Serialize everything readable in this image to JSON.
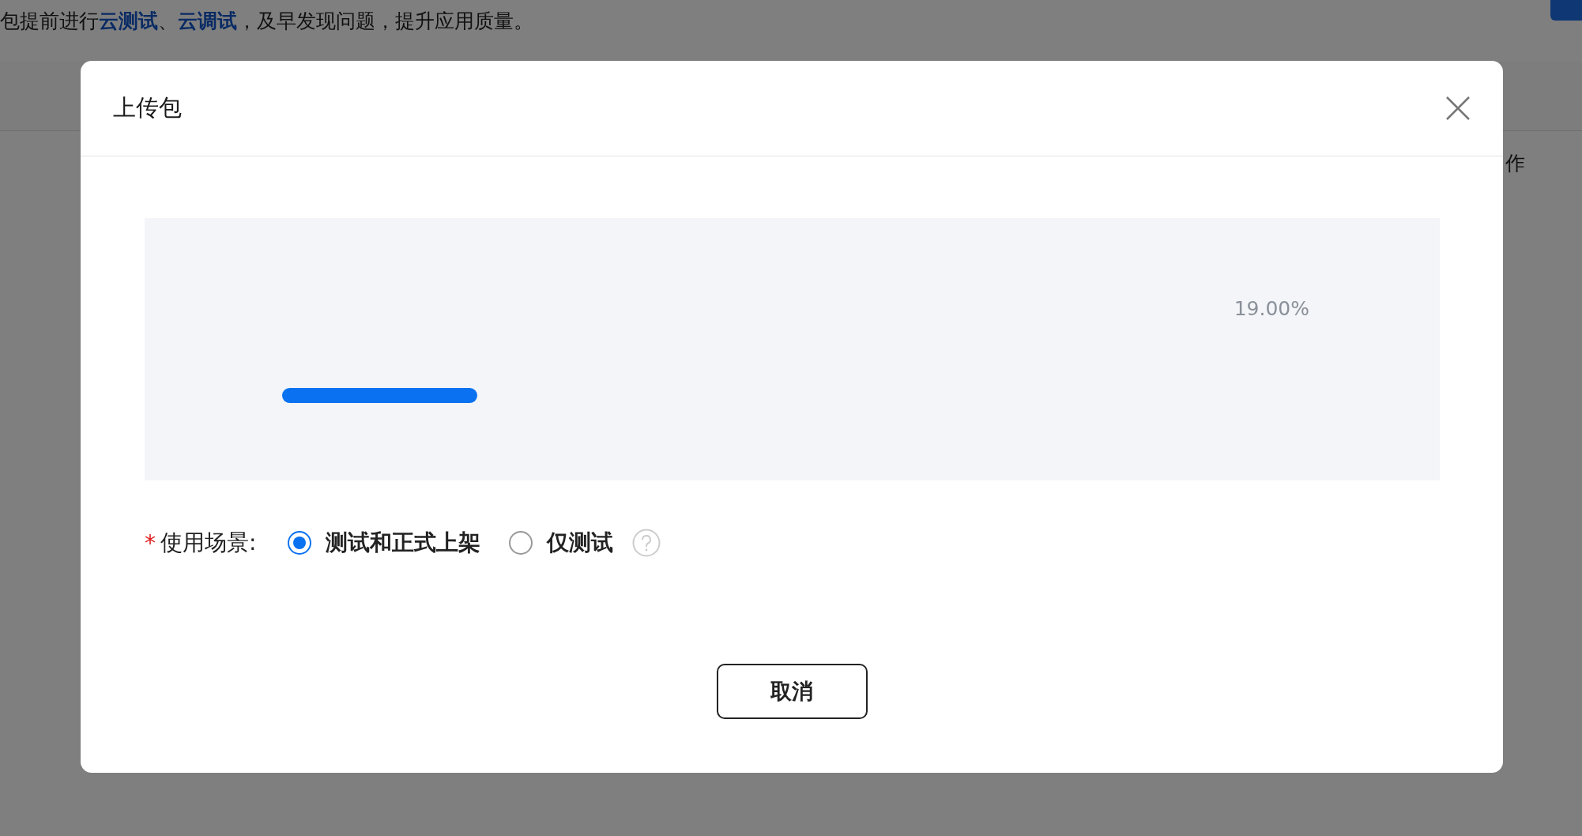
{
  "page": {
    "intro": [
      {
        "text": "包提前进行",
        "kind": "plain"
      },
      {
        "text": "云测试",
        "kind": "link"
      },
      {
        "text": "、",
        "kind": "plain"
      },
      {
        "text": "云调试",
        "kind": "link"
      },
      {
        "text": "，及早发现问题，提升应用质量。",
        "kind": "plain"
      }
    ],
    "column_header": "作"
  },
  "dialog": {
    "title": "上传包",
    "upload": {
      "level": 0.19,
      "reading": "19.00%"
    },
    "usage": {
      "label": "使用场景:",
      "required_mark": "*",
      "options": [
        {
          "label": "测试和正式上架",
          "selected": true
        },
        {
          "label": "仅测试",
          "selected": false
        }
      ]
    },
    "buttons": [
      "取消"
    ]
  }
}
